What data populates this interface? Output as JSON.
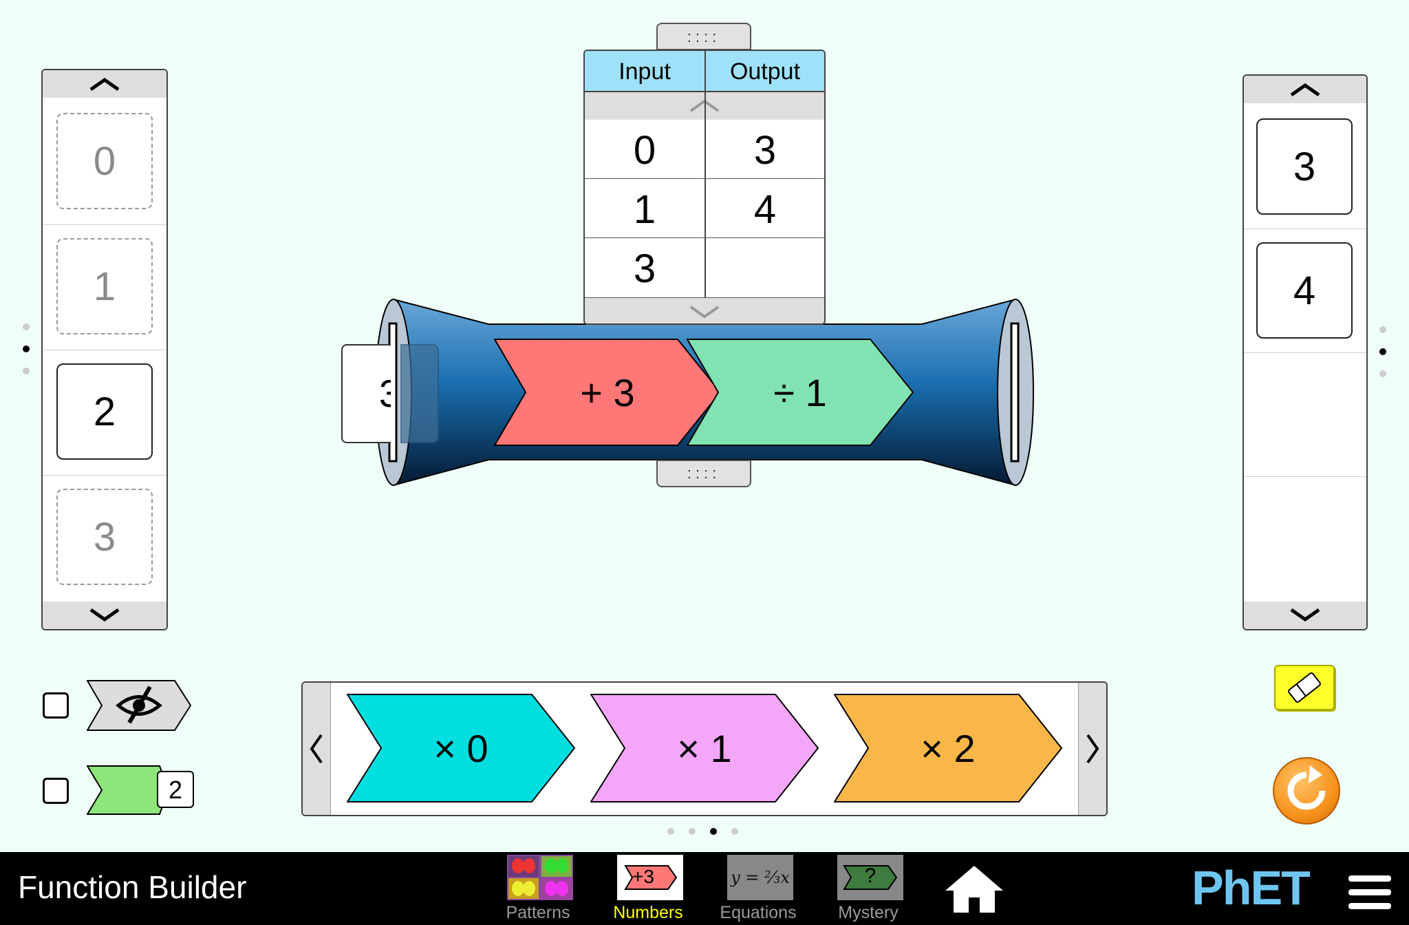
{
  "input_carousel": {
    "cards": [
      {
        "value": "0",
        "state": "ghost"
      },
      {
        "value": "1",
        "state": "ghost"
      },
      {
        "value": "2",
        "state": "solid"
      },
      {
        "value": "3",
        "state": "ghost"
      }
    ],
    "page_dots": 3,
    "active_dot": 2
  },
  "output_carousel": {
    "cards": [
      "3",
      "4",
      "",
      ""
    ],
    "page_dots": 3,
    "active_dot": 2
  },
  "table": {
    "headers": [
      "Input",
      "Output"
    ],
    "rows": [
      {
        "input": "0",
        "output": "3"
      },
      {
        "input": "1",
        "output": "4"
      },
      {
        "input": "3",
        "output": ""
      }
    ],
    "grip_label": "::::"
  },
  "builder": {
    "input_card_value": "3",
    "functions": [
      {
        "label": "+ 3",
        "color": "#ff7777"
      },
      {
        "label": "÷ 1",
        "color": "#80e3b1"
      }
    ],
    "tube_color": "#1a6fb0"
  },
  "function_carousel": {
    "items": [
      {
        "label": "× 0",
        "color": "#00dee0"
      },
      {
        "label": "× 1",
        "color": "#f4a6f8"
      },
      {
        "label": "× 2",
        "color": "#f9b74a"
      }
    ],
    "page_dots": 4,
    "active_dot": 3
  },
  "options": {
    "hide_functions_icon": "eye-slash-icon",
    "see_inside_value": "2"
  },
  "tools": {
    "eraser_color": "#ffff2a",
    "reset_color": "#f7931e"
  },
  "navbar": {
    "title": "Function Builder",
    "tabs": [
      {
        "label": "Patterns",
        "active": false
      },
      {
        "label": "Numbers",
        "active": true,
        "thumb_text": "+3"
      },
      {
        "label": "Equations",
        "active": false
      },
      {
        "label": "Mystery",
        "active": false,
        "thumb_text": "?"
      }
    ],
    "logo": "PhET"
  }
}
